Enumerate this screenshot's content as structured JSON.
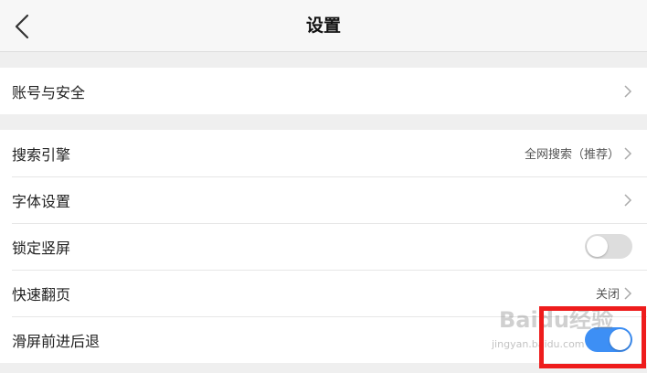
{
  "header": {
    "title": "设置"
  },
  "groups": [
    {
      "items": [
        {
          "label": "账号与安全",
          "type": "link"
        }
      ]
    },
    {
      "items": [
        {
          "label": "搜索引擎",
          "type": "link",
          "value": "全网搜索（推荐）"
        },
        {
          "label": "字体设置",
          "type": "link"
        },
        {
          "label": "锁定竖屏",
          "type": "toggle",
          "state": "off"
        },
        {
          "label": "快速翻页",
          "type": "link",
          "value": "关闭"
        },
        {
          "label": "滑屏前进后退",
          "type": "toggle",
          "state": "on"
        }
      ]
    }
  ],
  "watermark": {
    "logo": "Baidu经验",
    "url": "jingyan.baidu.com"
  },
  "colors": {
    "toggle_on": "#3d8ff5",
    "toggle_off": "#dddddd",
    "highlight": "#ee1c1c"
  }
}
